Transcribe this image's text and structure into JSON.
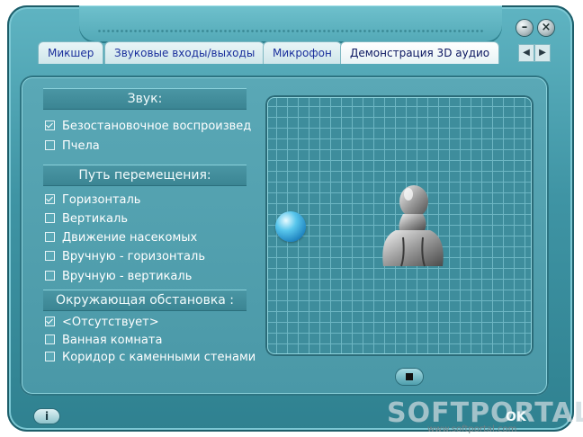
{
  "window": {
    "minimize_label": "–",
    "close_label": "×"
  },
  "tabs": [
    {
      "label": "Микшер"
    },
    {
      "label": "Звуковые входы/выходы"
    },
    {
      "label": "Микрофон"
    },
    {
      "label": "Демонстрация 3D аудио",
      "active": true
    }
  ],
  "tab_nav": {
    "prev": "◀",
    "next": "▶"
  },
  "sound": {
    "header": "Звук:",
    "options": [
      {
        "label": "Безостановочное воспроизвед",
        "checked": true
      },
      {
        "label": "Пчела",
        "checked": false
      }
    ]
  },
  "path": {
    "header": "Путь перемещения:",
    "options": [
      {
        "label": "Горизонталь",
        "checked": true
      },
      {
        "label": "Вертикаль",
        "checked": false
      },
      {
        "label": "Движение насекомых",
        "checked": false
      },
      {
        "label": "Вручную - горизонталь",
        "checked": false
      },
      {
        "label": "Вручную - вертикаль",
        "checked": false
      }
    ]
  },
  "environment": {
    "header": "Окружающая обстановка :",
    "options": [
      {
        "label": "<Отсутствует>",
        "checked": true
      },
      {
        "label": "Ванная комната",
        "checked": false
      },
      {
        "label": "Коридор с каменными стенами",
        "checked": false
      }
    ]
  },
  "footer": {
    "info_label": "i",
    "ok_label": "OK",
    "watermark": "SOFTPORTAL",
    "watermark_url": "www.softportal.com"
  },
  "colors": {
    "tab_text": "#1a2f9c",
    "panel": "#4a98a7",
    "grid": "#6db6c3"
  }
}
